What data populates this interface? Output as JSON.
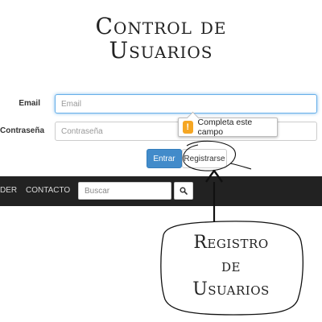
{
  "heading": {
    "line1": "Control de",
    "line2": "Usuarios"
  },
  "form": {
    "email_label": "Email",
    "email_placeholder": "Email",
    "password_label": "Contraseña",
    "password_placeholder": "Contraseña",
    "validation_message": "Completa este campo",
    "warning_glyph": "!",
    "submit_label": "Entrar",
    "register_label": "Registrarse"
  },
  "navbar": {
    "items": [
      "DER",
      "CONTACTO"
    ],
    "search_placeholder": "Buscar",
    "search_icon": "search-icon"
  },
  "annotation": {
    "line1": "Registro",
    "line2": "de",
    "line3": "Usuarios"
  },
  "colors": {
    "primary": "#428bca",
    "navbar": "#222222",
    "focus": "#66afe9",
    "warning": "#f5a623"
  }
}
